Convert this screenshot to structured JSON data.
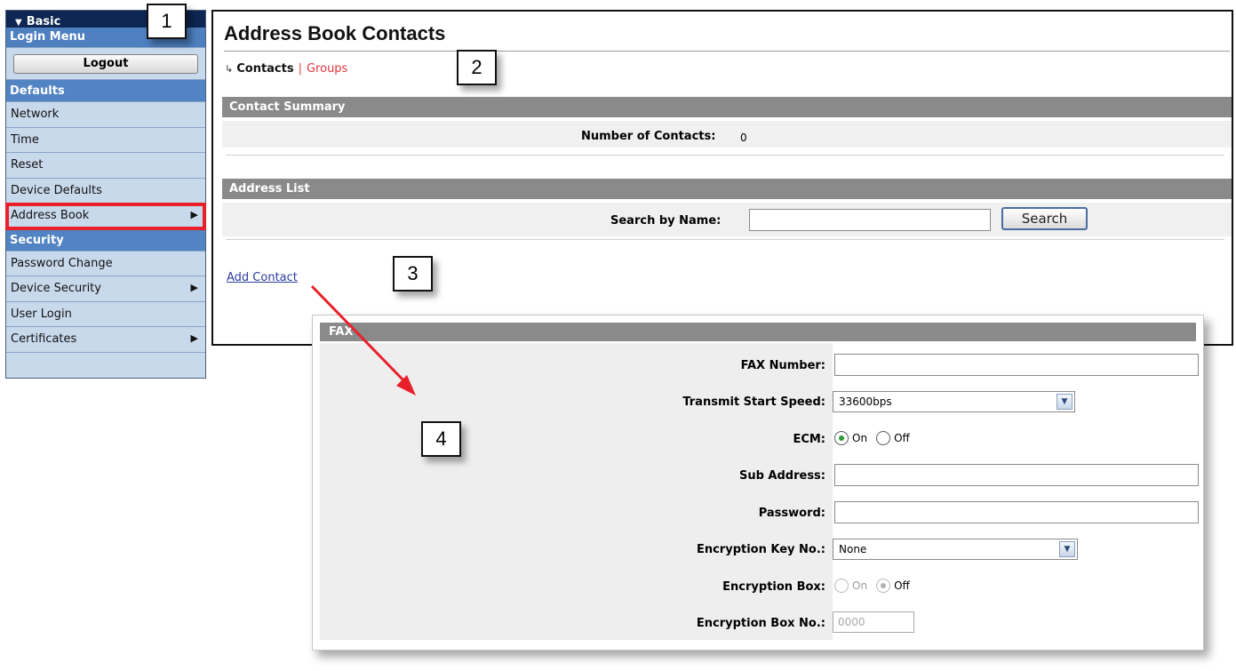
{
  "sidebar": {
    "basic_label": "Basic",
    "login_menu_label": "Login Menu",
    "logout_label": "Logout",
    "defaults_label": "Defaults",
    "defaults_items": [
      {
        "label": "Network",
        "has_submenu": false
      },
      {
        "label": "Time",
        "has_submenu": false
      },
      {
        "label": "Reset",
        "has_submenu": false
      },
      {
        "label": "Device Defaults",
        "has_submenu": false
      },
      {
        "label": "Address Book",
        "has_submenu": true,
        "highlighted": true
      }
    ],
    "security_label": "Security",
    "security_items": [
      {
        "label": "Password Change",
        "has_submenu": false
      },
      {
        "label": "Device Security",
        "has_submenu": true
      },
      {
        "label": "User Login",
        "has_submenu": false
      },
      {
        "label": "Certificates",
        "has_submenu": true
      }
    ]
  },
  "main": {
    "title": "Address Book Contacts",
    "subnav": {
      "current": "Contacts",
      "separator": "|",
      "other": "Groups"
    },
    "contact_summary": {
      "heading": "Contact Summary",
      "count_label": "Number of Contacts:",
      "count_value": "0"
    },
    "address_list": {
      "heading": "Address List",
      "search_label": "Search by Name:",
      "search_value": "",
      "search_button": "Search"
    },
    "add_contact_link": "Add Contact"
  },
  "fax_form": {
    "heading": "FAX",
    "fields": {
      "fax_number_label": "FAX Number:",
      "fax_number_value": "",
      "transmit_speed_label": "Transmit Start Speed:",
      "transmit_speed_value": "33600bps",
      "ecm_label": "ECM:",
      "ecm_on": "On",
      "ecm_off": "Off",
      "ecm_selected": "On",
      "sub_address_label": "Sub Address:",
      "sub_address_value": "",
      "password_label": "Password:",
      "password_value": "",
      "encryption_key_label": "Encryption Key No.:",
      "encryption_key_value": "None",
      "encryption_box_label": "Encryption Box:",
      "encryption_box_on": "On",
      "encryption_box_off": "Off",
      "encryption_box_selected": "Off",
      "encryption_box_no_label": "Encryption Box No.:",
      "encryption_box_no_value": "0000"
    }
  },
  "callouts": [
    "1",
    "2",
    "3",
    "4"
  ],
  "colors": {
    "highlight_red": "#e8202a",
    "sidebar_header_dark": "#0d2752",
    "sidebar_section": "#5283c2",
    "sidebar_item_bg": "#c9d9ec",
    "section_bar_gray": "#8a8a8a",
    "link_red": "#e0343a",
    "link_blue": "#2c3ca0",
    "radio_green": "#2a9a3a"
  },
  "icons": {
    "basic_toggle": "triangle-down-icon",
    "submenu": "triangle-right-icon",
    "subnav_arrow": "return-arrow-icon",
    "dropdown": "chevron-down-icon",
    "annotation": "red-arrow-icon"
  }
}
